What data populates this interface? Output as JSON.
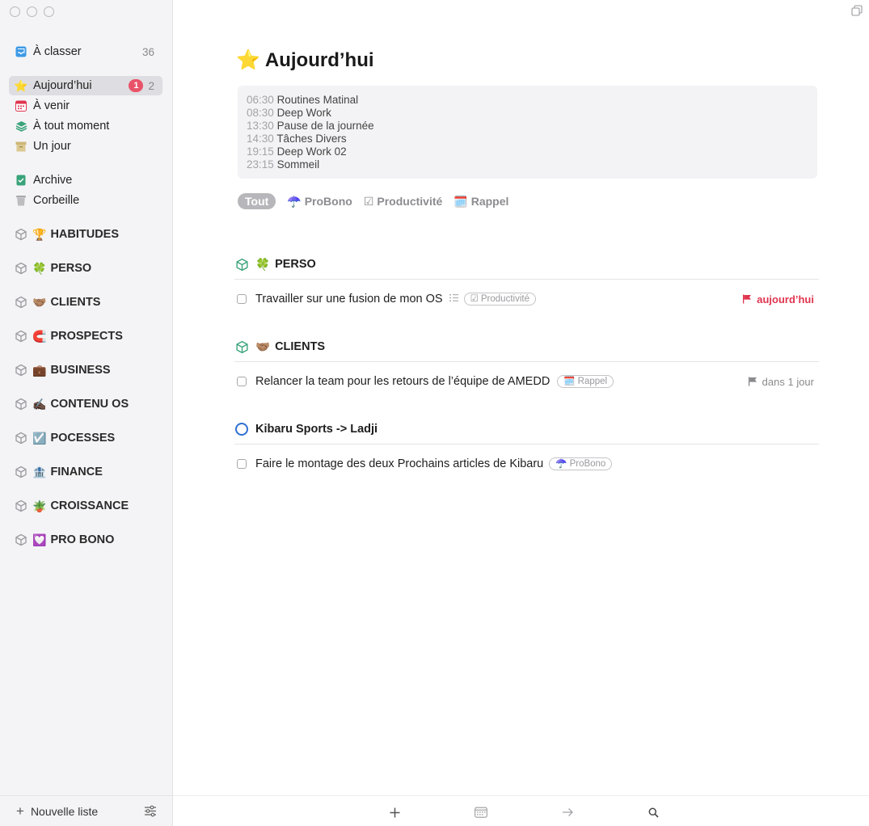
{
  "sidebar": {
    "inbox": {
      "label": "À classer",
      "count": "36"
    },
    "today": {
      "label": "Aujourd’hui",
      "badge": "1",
      "count": "2"
    },
    "upcoming": {
      "label": "À venir"
    },
    "anytime": {
      "label": "À tout moment"
    },
    "someday": {
      "label": "Un jour"
    },
    "logbook": {
      "label": "Archive"
    },
    "trash": {
      "label": "Corbeille"
    },
    "areas": [
      {
        "emoji": "🏆",
        "label": "HABITUDES"
      },
      {
        "emoji": "🍀",
        "label": "PERSO"
      },
      {
        "emoji": "🤝🏽",
        "label": "CLIENTS"
      },
      {
        "emoji": "🧲",
        "label": "PROSPECTS"
      },
      {
        "emoji": "💼",
        "label": "BUSINESS"
      },
      {
        "emoji": "✍🏿",
        "label": "CONTENU OS"
      },
      {
        "emoji": "☑️",
        "label": "POCESSES"
      },
      {
        "emoji": "🏦",
        "label": "FINANCE"
      },
      {
        "emoji": "🪴",
        "label": "CROISSANCE"
      },
      {
        "emoji": "💟",
        "label": "PRO BONO"
      }
    ],
    "footer": {
      "new_list": "Nouvelle liste"
    }
  },
  "main": {
    "title_emoji": "⭐",
    "title": "Aujourd’hui",
    "calendar": [
      {
        "time": "06:30",
        "name": "Routines Matinal"
      },
      {
        "time": "08:30",
        "name": "Deep Work"
      },
      {
        "time": "13:30",
        "name": "Pause de la journée"
      },
      {
        "time": "14:30",
        "name": "Tâches Divers"
      },
      {
        "time": "19:15",
        "name": "Deep Work 02"
      },
      {
        "time": "23:15",
        "name": "Sommeil"
      }
    ],
    "tags": {
      "all": "Tout",
      "probono": {
        "emoji": "☂️",
        "label": "ProBono"
      },
      "productivite": {
        "emoji": "☑",
        "label": "Productivité"
      },
      "rappel": {
        "emoji": "🗓️",
        "label": "Rappel"
      }
    },
    "sections": [
      {
        "emoji": "🍀",
        "title": "PERSO",
        "task": {
          "title": "Travailler sur une fusion de mon OS",
          "tag_emoji": "☑",
          "tag": "Productivité",
          "due": "aujourd’hui"
        }
      },
      {
        "emoji": "🤝🏽",
        "title": "CLIENTS",
        "task": {
          "title": "Relancer la team pour les retours de l’équipe de AMEDD",
          "tag_emoji": "🗓️",
          "tag": "Rappel",
          "due": "dans 1 jour"
        }
      },
      {
        "title": "Kibaru Sports -> Ladji",
        "task": {
          "title": "Faire le montage des deux Prochains articles de Kibaru",
          "tag_emoji": "☂️",
          "tag": "ProBono"
        }
      }
    ]
  },
  "colors": {
    "accent_red": "#e0354f",
    "project_blue": "#2f6fd3",
    "area_green": "#3aa37a"
  }
}
